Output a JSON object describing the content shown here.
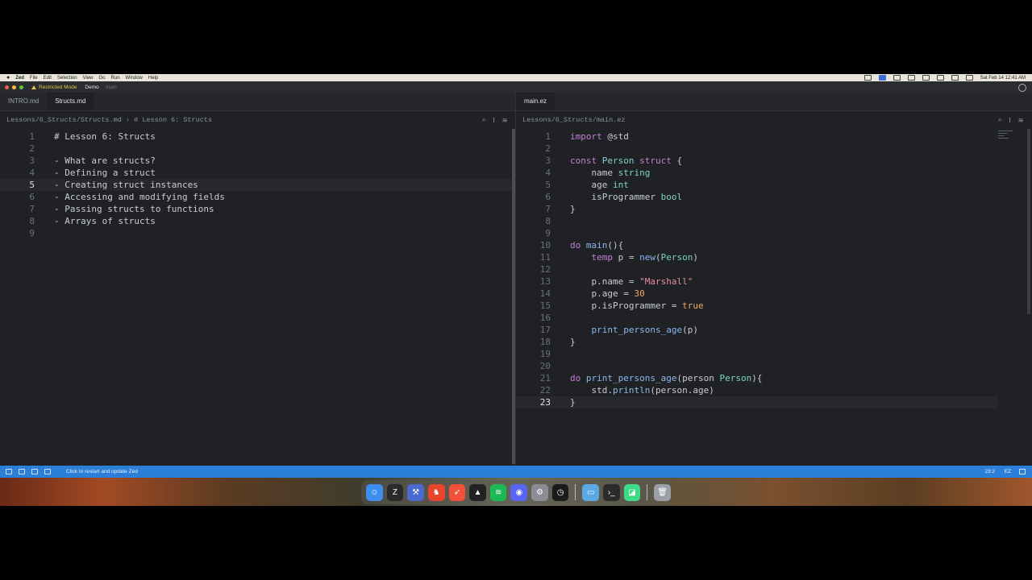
{
  "menubar": {
    "apple": "",
    "items": [
      "Zed",
      "File",
      "Edit",
      "Selection",
      "View",
      "Go",
      "Run",
      "Window",
      "Help"
    ],
    "clock": "Sat Feb 14 12:41 AM"
  },
  "titlebar": {
    "restricted": "Restricted Mode",
    "project": "Demo",
    "branch": "main"
  },
  "left_pane": {
    "tabs": [
      {
        "label": "INTRO.md"
      },
      {
        "label": "Structs.md"
      }
    ],
    "breadcrumb": "Lessons/6_Structs/Structs.md › # Lesson 6: Structs",
    "current_line": 5,
    "lines": [
      {
        "n": "1",
        "text": "# Lesson 6: Structs"
      },
      {
        "n": "2",
        "text": ""
      },
      {
        "n": "3",
        "text": "- What are structs?"
      },
      {
        "n": "4",
        "text": "- Defining a struct"
      },
      {
        "n": "5",
        "text": "- Creating struct instances"
      },
      {
        "n": "6",
        "text": "- Accessing and modifying fields"
      },
      {
        "n": "7",
        "text": "- Passing structs to functions"
      },
      {
        "n": "8",
        "text": "- Arrays of structs"
      },
      {
        "n": "9",
        "text": ""
      }
    ]
  },
  "right_pane": {
    "tabs": [
      {
        "label": "main.ez"
      }
    ],
    "breadcrumb": "Lessons/6_Structs/main.ez",
    "current_line": 23,
    "lines": [
      {
        "n": "1",
        "indent": "",
        "tokens": [
          [
            "kw",
            "import"
          ],
          [
            "p",
            " @std"
          ]
        ]
      },
      {
        "n": "2",
        "indent": "",
        "tokens": []
      },
      {
        "n": "3",
        "indent": "",
        "tokens": [
          [
            "kw",
            "const"
          ],
          [
            "p",
            " "
          ],
          [
            "ty",
            "Person"
          ],
          [
            "p",
            " "
          ],
          [
            "kw",
            "struct"
          ],
          [
            "p",
            " {"
          ]
        ]
      },
      {
        "n": "4",
        "indent": "    ",
        "tokens": [
          [
            "p",
            "name "
          ],
          [
            "ty",
            "string"
          ]
        ]
      },
      {
        "n": "5",
        "indent": "    ",
        "tokens": [
          [
            "p",
            "age "
          ],
          [
            "ty",
            "int"
          ]
        ]
      },
      {
        "n": "6",
        "indent": "    ",
        "tokens": [
          [
            "p",
            "isProgrammer "
          ],
          [
            "ty",
            "bool"
          ]
        ]
      },
      {
        "n": "7",
        "indent": "",
        "tokens": [
          [
            "p",
            "}"
          ]
        ]
      },
      {
        "n": "8",
        "indent": "",
        "tokens": []
      },
      {
        "n": "9",
        "indent": "",
        "tokens": []
      },
      {
        "n": "10",
        "indent": "",
        "tokens": [
          [
            "kw",
            "do"
          ],
          [
            "p",
            " "
          ],
          [
            "fn",
            "main"
          ],
          [
            "p",
            "(){"
          ]
        ]
      },
      {
        "n": "11",
        "indent": "    ",
        "tokens": [
          [
            "kw",
            "temp"
          ],
          [
            "p",
            " p = "
          ],
          [
            "fn",
            "new"
          ],
          [
            "p",
            "("
          ],
          [
            "ty",
            "Person"
          ],
          [
            "p",
            ")"
          ]
        ]
      },
      {
        "n": "12",
        "indent": "",
        "tokens": []
      },
      {
        "n": "13",
        "indent": "    ",
        "tokens": [
          [
            "p",
            "p.name = "
          ],
          [
            "st",
            "\"Marshall\""
          ]
        ]
      },
      {
        "n": "14",
        "indent": "    ",
        "tokens": [
          [
            "p",
            "p.age = "
          ],
          [
            "nm",
            "30"
          ]
        ]
      },
      {
        "n": "15",
        "indent": "    ",
        "tokens": [
          [
            "p",
            "p.isProgrammer = "
          ],
          [
            "bl",
            "true"
          ]
        ]
      },
      {
        "n": "16",
        "indent": "",
        "tokens": []
      },
      {
        "n": "17",
        "indent": "    ",
        "tokens": [
          [
            "fn",
            "print_persons_age"
          ],
          [
            "p",
            "(p)"
          ]
        ]
      },
      {
        "n": "18",
        "indent": "",
        "tokens": [
          [
            "p",
            "}"
          ]
        ]
      },
      {
        "n": "19",
        "indent": "",
        "tokens": []
      },
      {
        "n": "20",
        "indent": "",
        "tokens": []
      },
      {
        "n": "21",
        "indent": "",
        "tokens": [
          [
            "kw",
            "do"
          ],
          [
            "p",
            " "
          ],
          [
            "fn",
            "print_persons_age"
          ],
          [
            "p",
            "(person "
          ],
          [
            "ty",
            "Person"
          ],
          [
            "p",
            "){"
          ]
        ]
      },
      {
        "n": "22",
        "indent": "    ",
        "tokens": [
          [
            "p",
            "std."
          ],
          [
            "fn",
            "println"
          ],
          [
            "p",
            "(person.age)"
          ]
        ]
      },
      {
        "n": "23",
        "indent": "",
        "tokens": [
          [
            "p",
            "}"
          ]
        ]
      }
    ]
  },
  "statusbar": {
    "message": "Click to restart and update Zed",
    "position": "23:2",
    "language": "EZ"
  },
  "dock": {
    "apps": [
      {
        "name": "finder",
        "color": "#3d8ef0",
        "glyph": "☺"
      },
      {
        "name": "zed",
        "color": "#2a2a2a",
        "glyph": "Z"
      },
      {
        "name": "xcode",
        "color": "#4a6ad0",
        "glyph": "⚒"
      },
      {
        "name": "brave",
        "color": "#e8452c",
        "glyph": "♞"
      },
      {
        "name": "swift",
        "color": "#f05138",
        "glyph": "➶"
      },
      {
        "name": "affinity",
        "color": "#222222",
        "glyph": "▲"
      },
      {
        "name": "spotify",
        "color": "#1db954",
        "glyph": "≋"
      },
      {
        "name": "discord",
        "color": "#5865f2",
        "glyph": "◉"
      },
      {
        "name": "settings",
        "color": "#8a8d93",
        "glyph": "⚙"
      },
      {
        "name": "activity",
        "color": "#1b1b1b",
        "glyph": "◷"
      },
      {
        "name": "folder",
        "color": "#5aa9e6",
        "glyph": "▭"
      },
      {
        "name": "terminal",
        "color": "#2b2b2b",
        "glyph": "›_"
      },
      {
        "name": "android",
        "color": "#3ddc84",
        "glyph": "◪"
      },
      {
        "name": "trash",
        "color": "#9aa0a6",
        "glyph": "🗑"
      }
    ]
  },
  "colors": {
    "accent": "#2b7fd8",
    "bg": "#1f2125"
  }
}
